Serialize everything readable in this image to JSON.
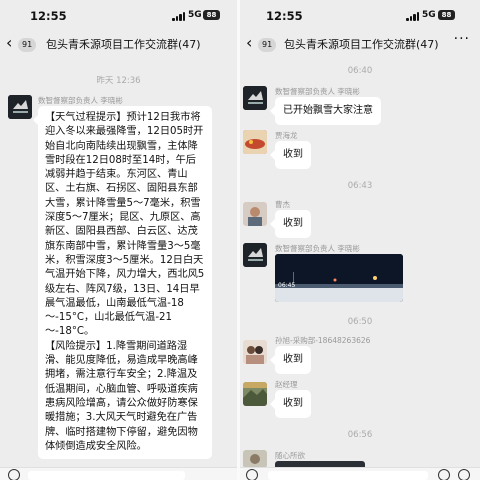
{
  "status_bar": {
    "time": "12:55",
    "network": "5G",
    "battery": "88"
  },
  "header": {
    "back_badge": "91",
    "title": "包头青禾源项目工作交流群(47)",
    "more": "···"
  },
  "left_pane": {
    "timestamp": "昨天 12:36",
    "message": {
      "sender": "数智督察部负责人 李晓彬",
      "text": "【天气过程提示】预计12日我市将迎入冬以来最强降雪，12日05时开始自北向南陆续出现飘雪，主体降雪时段在12日08时至14时，午后减弱并趋于结束。东河区、青山区、土右旗、石拐区、固阳县东部大雪，累计降雪量5～7毫米，积雪深度5～7厘米；昆区、九原区、高新区、固阳县西部、白云区、达茂旗东南部中雪，累计降雪量3～5毫米，积雪深度3～5厘米。12日白天气温开始下降，风力增大，西北风5级左右、阵风7级，13日、14日早晨气温最低，山南最低气温-18～-15°C，山北最低气温-21～-18°C。\n【风险提示】1.降雪期间道路湿滑、能见度降低，易造成早晚高峰拥堵，需注意行车安全；2.降温及低温期间，心脑血管、呼吸道疾病患病风险增高，请公众做好防寒保暖措施；3.大风天气时避免在广告牌、临时搭建物下停留，避免因物体倾倒造成安全风险。"
    }
  },
  "right_pane": {
    "timestamps": [
      "06:40",
      "06:43",
      "06:50",
      "06:56"
    ],
    "messages": [
      {
        "sender": "数智督察部负责人 李晓彬",
        "text": "已开始飘雪大家注意"
      },
      {
        "sender": "贾海龙",
        "text": "收到"
      },
      {
        "sender": "曹杰",
        "text": "收到"
      },
      {
        "sender": "数智督察部负责人 李晓彬",
        "text": ""
      },
      {
        "sender": "孙旭-采购部-18648263626",
        "text": "收到"
      },
      {
        "sender": "赵经理",
        "text": "收到"
      },
      {
        "sender": "随心所欲",
        "text": ""
      }
    ],
    "photo_overlay": "06:45"
  }
}
